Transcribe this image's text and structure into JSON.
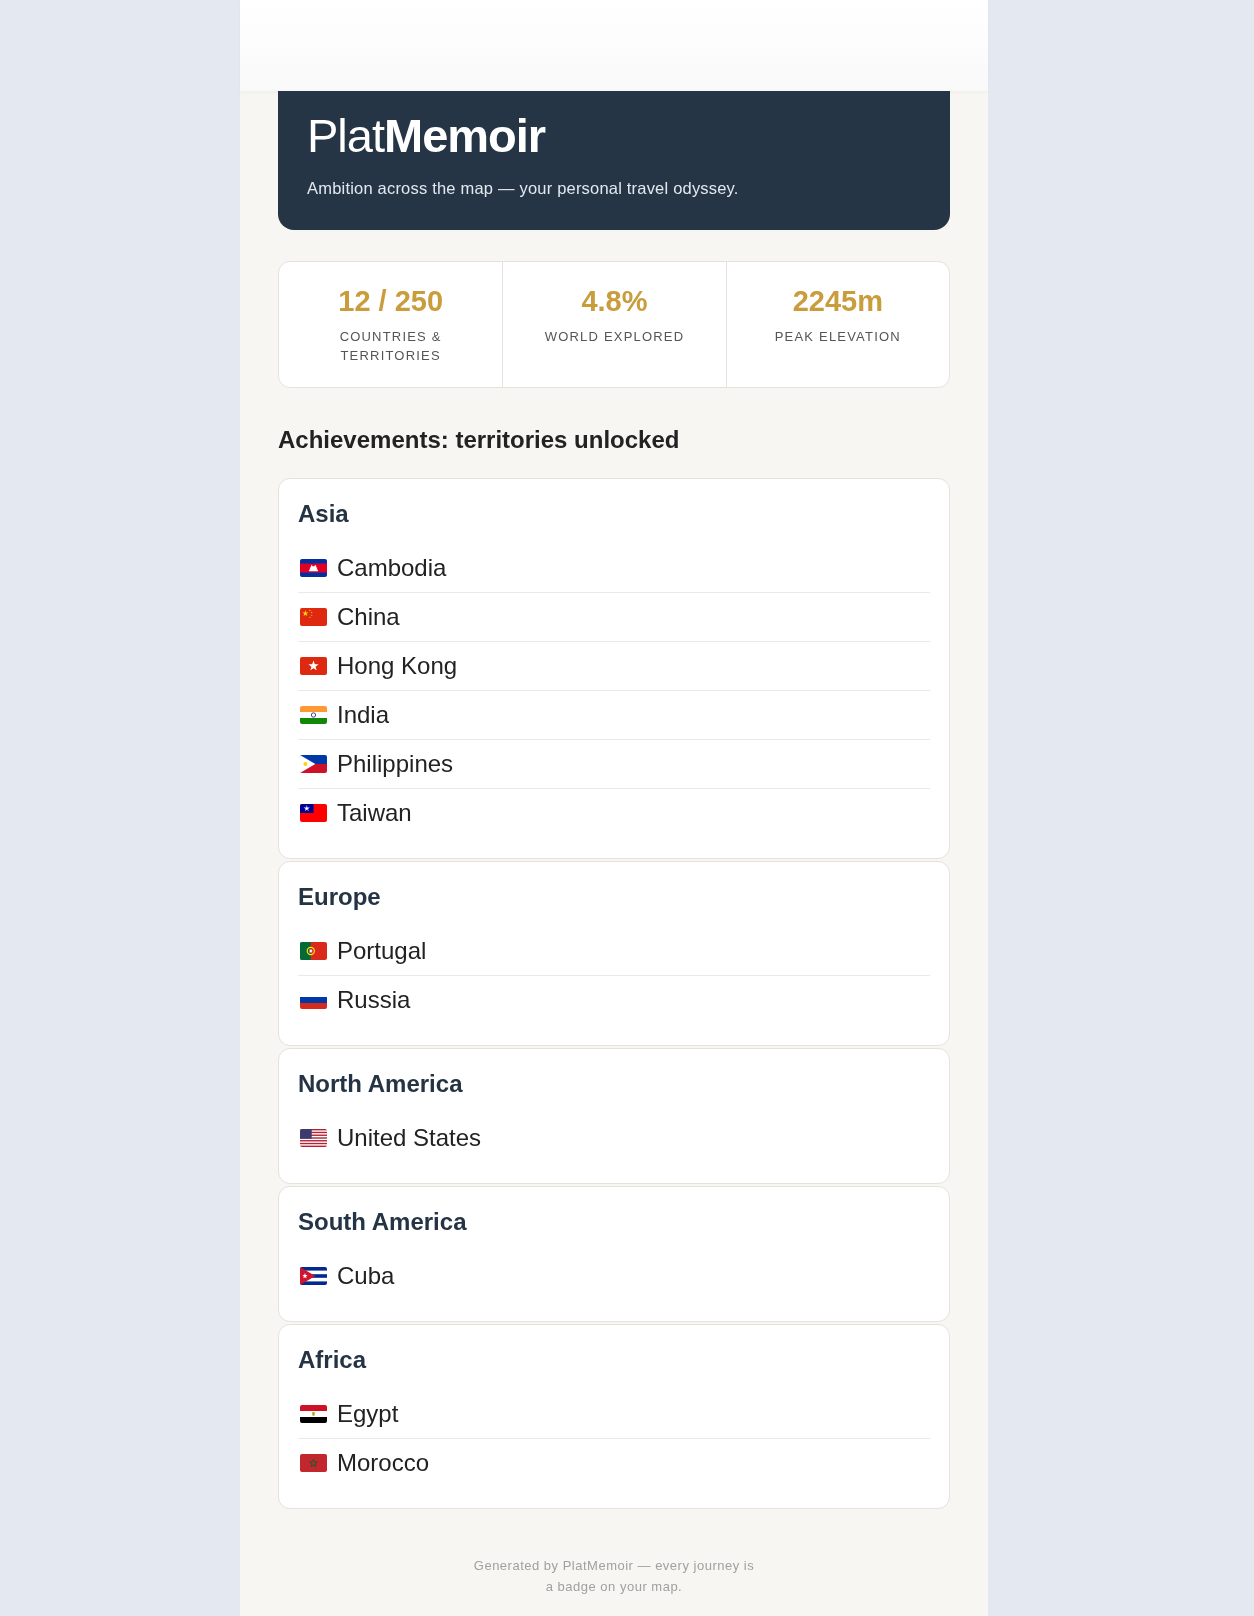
{
  "header": {
    "logo": "Plat**Memoir**",
    "tagline": "Ambition across the map — your personal travel odyssey."
  },
  "stats": [
    {
      "value": "12 / 250",
      "label": "COUNTRIES & TERRITORIES"
    },
    {
      "value": "4.8%",
      "label": "WORLD EXPLORED"
    },
    {
      "value": "2245m",
      "label": "PEAK ELEVATION"
    }
  ],
  "section_title": "Achievements: territories unlocked",
  "regions": [
    {
      "name": "Asia",
      "countries": [
        {
          "name": "Cambodia",
          "kind": "kh"
        },
        {
          "name": "China",
          "kind": "cn"
        },
        {
          "name": "Hong Kong",
          "kind": "hk"
        },
        {
          "name": "India",
          "kind": "in"
        },
        {
          "name": "Philippines",
          "kind": "ph"
        },
        {
          "name": "Taiwan",
          "kind": "tw"
        }
      ]
    },
    {
      "name": "Europe",
      "countries": [
        {
          "name": "Portugal",
          "kind": "pt"
        },
        {
          "name": "Russia",
          "kind": "ru"
        }
      ]
    },
    {
      "name": "North America",
      "countries": [
        {
          "name": "United States",
          "kind": "us"
        }
      ]
    },
    {
      "name": "South America",
      "countries": [
        {
          "name": "Cuba",
          "kind": "cu"
        }
      ]
    },
    {
      "name": "Africa",
      "countries": [
        {
          "name": "Egypt",
          "kind": "eg"
        },
        {
          "name": "Morocco",
          "kind": "ma"
        }
      ]
    }
  ],
  "footer": "Generated by PlatMemoir — every journey is a badge on your map."
}
